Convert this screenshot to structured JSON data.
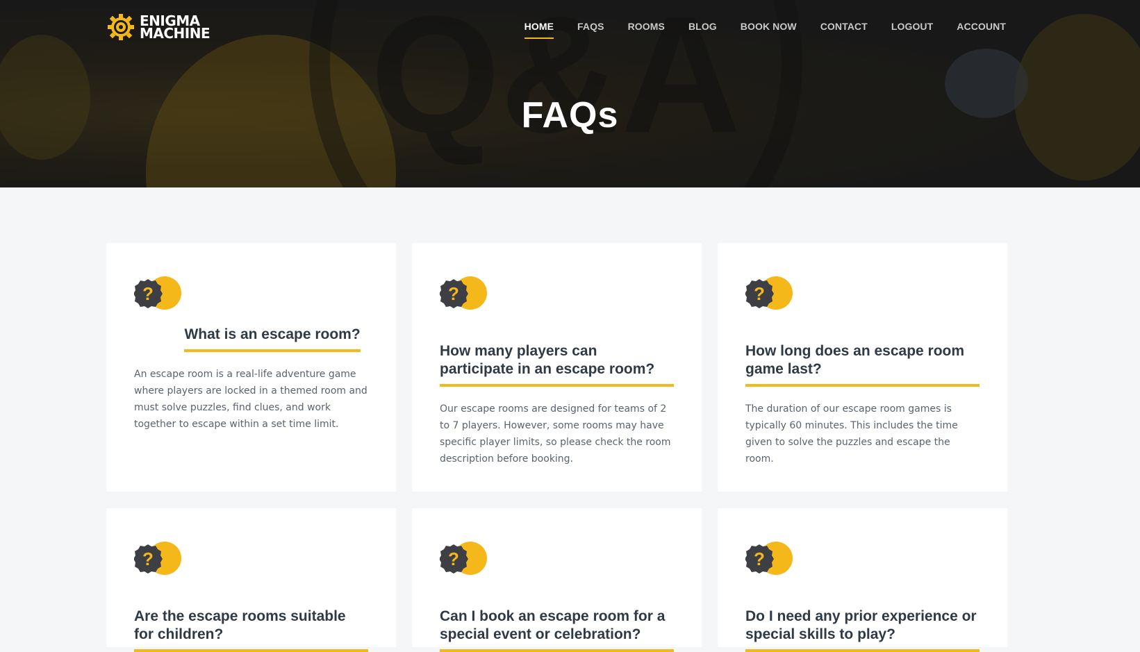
{
  "brand": {
    "line1": "ENIGMA",
    "line2": "MACHINE"
  },
  "nav": [
    {
      "label": "HOME",
      "active": true
    },
    {
      "label": "FAQS",
      "active": false
    },
    {
      "label": "ROOMS",
      "active": false
    },
    {
      "label": "BLOG",
      "active": false
    },
    {
      "label": "BOOK NOW",
      "active": false
    },
    {
      "label": "CONTACT",
      "active": false
    },
    {
      "label": "LOGOUT",
      "active": false
    },
    {
      "label": "ACCOUNT",
      "active": false
    }
  ],
  "hero": {
    "title": "FAQs",
    "bg_text": "Q&A"
  },
  "faqs": [
    {
      "question": "What is an escape room?",
      "answer": "An escape room is a real-life adventure game where players are locked in a themed room and must solve puzzles, find clues, and work together to escape within a set time limit."
    },
    {
      "question": "How many players can participate in an escape room?",
      "answer": "Our escape rooms are designed for teams of 2 to 7 players. However, some rooms may have specific player limits, so please check the room description before booking."
    },
    {
      "question": "How long does an escape room game last?",
      "answer": "The duration of our escape room games is typically 60 minutes. This includes the time given to solve the puzzles and escape the room."
    },
    {
      "question": "Are the escape rooms suitable for children?",
      "answer": ""
    },
    {
      "question": "Can I book an escape room for a special event or celebration?",
      "answer": ""
    },
    {
      "question": "Do I need any prior experience or special skills to play?",
      "answer": ""
    }
  ],
  "colors": {
    "accent": "#f5b81a",
    "heading": "#2f3a47",
    "body": "#5a6370",
    "icon_dark": "#3d3f44"
  },
  "icons": {
    "logo": "gear-icon",
    "faq": "question-badge-icon"
  }
}
